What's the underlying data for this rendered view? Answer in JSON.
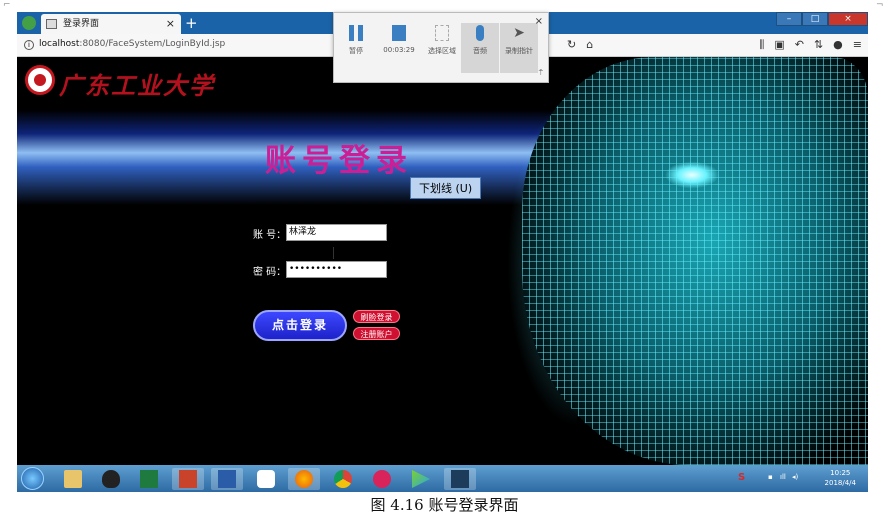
{
  "browser": {
    "tab_title": "登录界面",
    "tab_close": "×",
    "new_tab": "+",
    "url_host": "localhost",
    "url_path": ":8080/FaceSystem/LoginById.jsp"
  },
  "page": {
    "university_name": "广东工业大学",
    "title": "账号登录",
    "tooltip": "下划线 (U)",
    "account_label": "账 号：",
    "account_value": "林泽龙",
    "password_label": "密 码：",
    "password_value": "••••••••••",
    "login_button": "点击登录",
    "face_login_button": "刷脸登录",
    "register_button": "注册账户"
  },
  "recorder": {
    "pause_label": "暂停",
    "time": "00:03:29",
    "select_area_label": "选择区域",
    "audio_label": "音频",
    "record_cursor_label": "录制指针",
    "close": "×"
  },
  "taskbar": {
    "time": "10:25",
    "date": "2018/4/4"
  },
  "caption": "图 4.16 账号登录界面"
}
